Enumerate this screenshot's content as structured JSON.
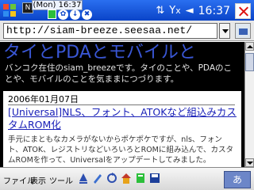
{
  "status": {
    "notify_clock": "(Mon) 16:37",
    "time": "16:37",
    "signal_glyph": "Y",
    "signal_off_glyph": "x",
    "speaker_glyph": "◄",
    "app_glyph": "N",
    "tray_glyphs": [
      "✿",
      "↓",
      "✖"
    ]
  },
  "address": {
    "url": "http://siam-breeze.seesaa.net/"
  },
  "blog": {
    "title": "タイとPDAとモバイルと",
    "description": "バンコク在住のsiam_breezeです。タイのことや、PDAのことや、モバイルのことを気ままにつづります。"
  },
  "post": {
    "date": "2006年01月07日",
    "title": "[Universal]NLS、フォント、ATOKなど組込みカスタムROM化",
    "body": "手元にまともなカメラがないからポケポケですが、nls、フォント、ATOK、レジストリなどいろいろとROMに組み込んで、カスタムROMを作って、Universalをアップデートしてみました。"
  },
  "toolbar": {
    "menu_file": "ファイル",
    "menu_view": "表示",
    "menu_tools": "ツール",
    "input_method": "あ"
  },
  "colors": {
    "status_bar": "#0a44c8",
    "blog_title": "#3a57d6",
    "link": "#1a21b8",
    "page_bg": "#000000"
  },
  "scroll": {
    "position_fraction": 0.02,
    "visible_fraction": 0.17
  }
}
